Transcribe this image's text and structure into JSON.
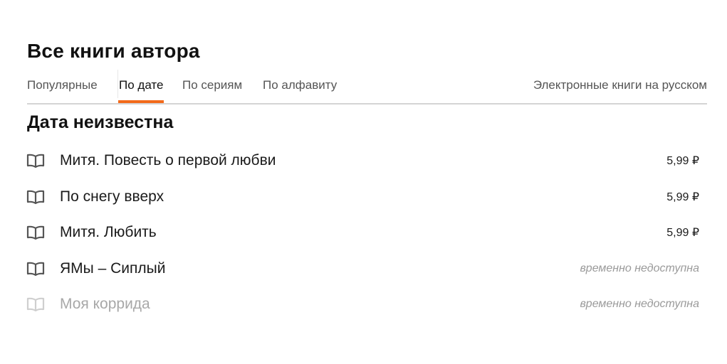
{
  "header": {
    "title": "Все книги автора"
  },
  "tabs": [
    {
      "label": "Популярные",
      "active": false
    },
    {
      "label": "По дате",
      "active": true
    },
    {
      "label": "По сериям",
      "active": false
    },
    {
      "label": "По алфавиту",
      "active": false
    }
  ],
  "filter": {
    "label": "Электронные книги на русском"
  },
  "section": {
    "title": "Дата неизвестна"
  },
  "books": [
    {
      "title": "Митя. Повесть о первой любви",
      "price": "5,99 ₽",
      "status": "",
      "available": true,
      "icon": "book-open-icon"
    },
    {
      "title": "По снегу вверх",
      "price": "5,99 ₽",
      "status": "",
      "available": true,
      "icon": "book-open-icon"
    },
    {
      "title": "Митя. Любить",
      "price": "5,99 ₽",
      "status": "",
      "available": true,
      "icon": "book-open-icon"
    },
    {
      "title": "ЯМы – Сиплый",
      "price": "",
      "status": "временно недоступна",
      "available": true,
      "icon": "book-open-icon"
    },
    {
      "title": "Моя коррида",
      "price": "",
      "status": "временно недоступна",
      "available": false,
      "icon": "book-open-icon"
    }
  ],
  "colors": {
    "accent": "#f26a1b",
    "text": "#111111",
    "muted": "#9a9a9a",
    "icon": "#555555",
    "icon_disabled": "#cfcfcf"
  }
}
